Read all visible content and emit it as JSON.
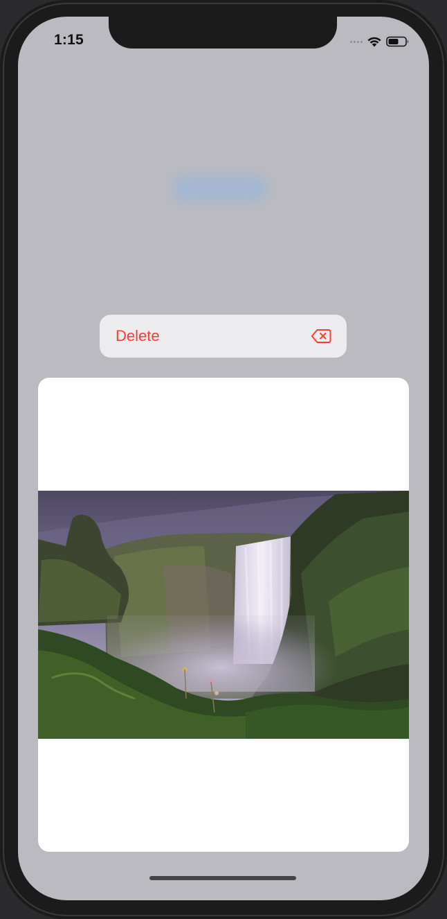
{
  "status_bar": {
    "time": "1:15",
    "icons": [
      "signal-dots-icon",
      "wifi-icon",
      "battery-icon"
    ]
  },
  "background": {
    "blurred_button_color": "#9fb6d6"
  },
  "context_menu": {
    "items": [
      {
        "label": "Delete",
        "icon": "delete-backward-icon",
        "color": "#ff3b30"
      }
    ]
  },
  "preview": {
    "image_subject": "waterfall-landscape"
  },
  "colors": {
    "screen_background": "#bbbac0",
    "menu_background": "#ececef",
    "destructive": "#ff3b30"
  }
}
